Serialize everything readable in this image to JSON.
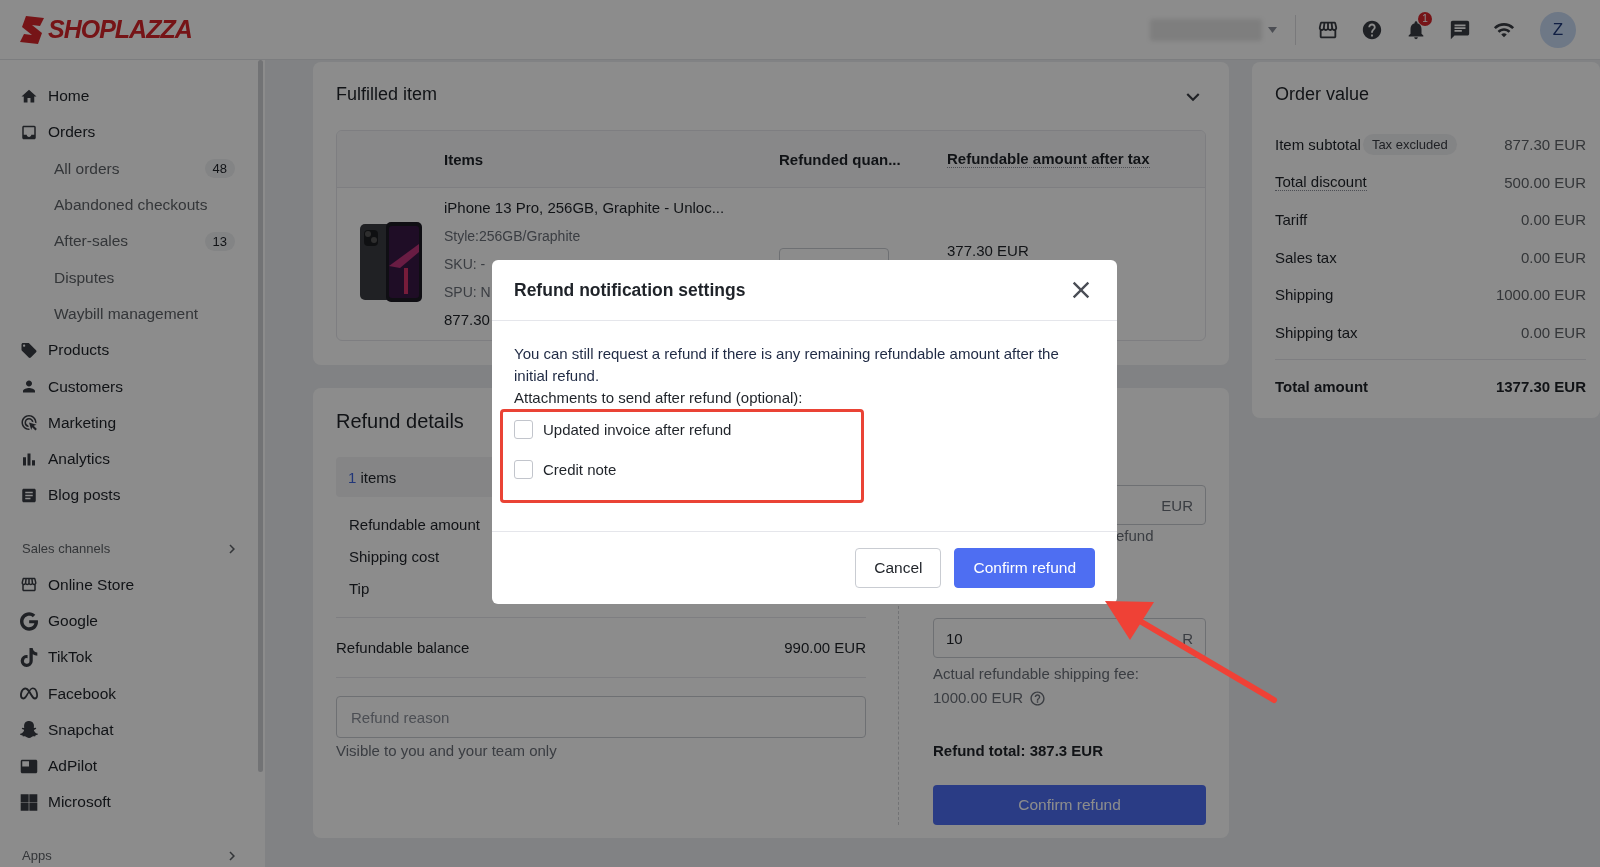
{
  "topbar": {
    "logo": "SHOPLAZZA",
    "notification_count": "1",
    "avatar": "Z"
  },
  "sidebar": {
    "items": [
      {
        "label": "Home"
      },
      {
        "label": "Orders",
        "children": [
          {
            "label": "All orders",
            "count": "48"
          },
          {
            "label": "Abandoned checkouts"
          },
          {
            "label": "After-sales",
            "count": "13"
          },
          {
            "label": "Disputes"
          },
          {
            "label": "Waybill management"
          }
        ]
      },
      {
        "label": "Products"
      },
      {
        "label": "Customers"
      },
      {
        "label": "Marketing"
      },
      {
        "label": "Analytics"
      },
      {
        "label": "Blog posts"
      }
    ],
    "sales_channels": {
      "title": "Sales channels",
      "items": [
        {
          "label": "Online Store"
        },
        {
          "label": "Google"
        },
        {
          "label": "TikTok"
        },
        {
          "label": "Facebook"
        },
        {
          "label": "Snapchat"
        },
        {
          "label": "AdPilot"
        },
        {
          "label": "Microsoft"
        }
      ]
    },
    "apps": {
      "title": "Apps"
    }
  },
  "fulfilled_item": {
    "title": "Fulfilled item",
    "columns": [
      {
        "label": "Items",
        "hint": false
      },
      {
        "label": "Refunded quan...",
        "hint": false
      },
      {
        "label": "Refundable amount after tax",
        "hint": true
      }
    ],
    "rows": [
      {
        "kind": "picture",
        "name": "iPhone 13 Pro, 256GB, Graphite - Unloc...",
        "style": "Style:256GB/Graphite",
        "sku": "SKU: -",
        "spu": "SPU: N",
        "price": "877.30",
        "refundable": "377.30 EUR"
      }
    ]
  },
  "refund_details": {
    "title": "Refund details",
    "items_count": "1",
    "items_label": "items",
    "rows": [
      "Refundable amount",
      "Shipping cost",
      "Tip"
    ],
    "balance": {
      "label": "Refundable balance",
      "value": "990.00 EUR"
    },
    "reason": {
      "placeholder": "Refund reason",
      "hint": "Visible to you and your team only"
    },
    "refund_field": {
      "suffix": "EUR",
      "hint": "efund"
    },
    "shipping_field": {
      "value": "10",
      "suffix": "R"
    },
    "shipping_note": "Actual refundable shipping fee:",
    "shipping_fee": "1000.00 EUR",
    "total": "Refund total: 387.3 EUR",
    "confirm": "Confirm refund"
  },
  "order_value": {
    "title": "Order value",
    "rows": [
      {
        "label": "Item subtotal",
        "tag": "Tax excluded",
        "value": "877.30 EUR",
        "hint": false
      },
      {
        "label": "Total discount",
        "value": "500.00 EUR",
        "hint": true
      },
      {
        "label": "Tariff",
        "value": "0.00 EUR",
        "hint": false
      },
      {
        "label": "Sales tax",
        "value": "0.00 EUR",
        "hint": false
      },
      {
        "label": "Shipping",
        "value": "1000.00 EUR",
        "hint": false
      },
      {
        "label": "Shipping tax",
        "value": "0.00 EUR",
        "hint": false
      }
    ],
    "total": {
      "label": "Total amount",
      "value": "1377.30 EUR"
    }
  },
  "modal": {
    "title": "Refund notification settings",
    "message": "You can still request a refund if there is any remaining refundable amount after the initial refund.",
    "attachments_label": "Attachments to send after refund (optional):",
    "options": [
      {
        "label": "Updated invoice after refund",
        "checked": false
      },
      {
        "label": "Credit note",
        "checked": false
      }
    ],
    "buttons": [
      {
        "label": "Cancel",
        "kind": "secondary"
      },
      {
        "label": "Confirm refund",
        "kind": "primary"
      }
    ]
  }
}
